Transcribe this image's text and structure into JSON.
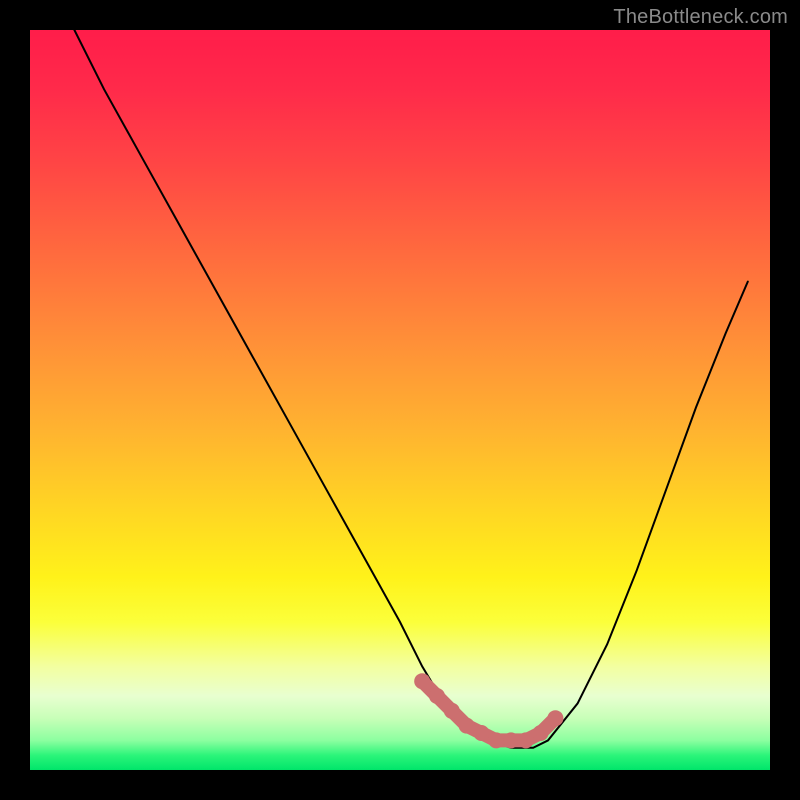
{
  "watermark": "TheBottleneck.com",
  "colors": {
    "curve_stroke": "#000000",
    "marker_fill": "#cc6f6f",
    "gradient_top": "#ff1d4a",
    "gradient_bottom": "#00e56a",
    "frame": "#000000"
  },
  "chart_data": {
    "type": "line",
    "title": "",
    "xlabel": "",
    "ylabel": "",
    "x_range": [
      0,
      100
    ],
    "y_range": [
      0,
      100
    ],
    "series": [
      {
        "name": "bottleneck-curve",
        "x": [
          6,
          10,
          15,
          20,
          25,
          30,
          35,
          40,
          45,
          50,
          53,
          56,
          59,
          62,
          65,
          68,
          70,
          74,
          78,
          82,
          86,
          90,
          94,
          97
        ],
        "values": [
          100,
          92,
          83,
          74,
          65,
          56,
          47,
          38,
          29,
          20,
          14,
          9,
          6,
          4,
          3,
          3,
          4,
          9,
          17,
          27,
          38,
          49,
          59,
          66
        ]
      }
    ],
    "markers": {
      "name": "valley-highlight",
      "x": [
        53,
        55,
        57,
        59,
        61,
        63,
        65,
        67,
        69,
        71
      ],
      "values": [
        12,
        10,
        8,
        6,
        5,
        4,
        4,
        4,
        5,
        7
      ]
    }
  }
}
